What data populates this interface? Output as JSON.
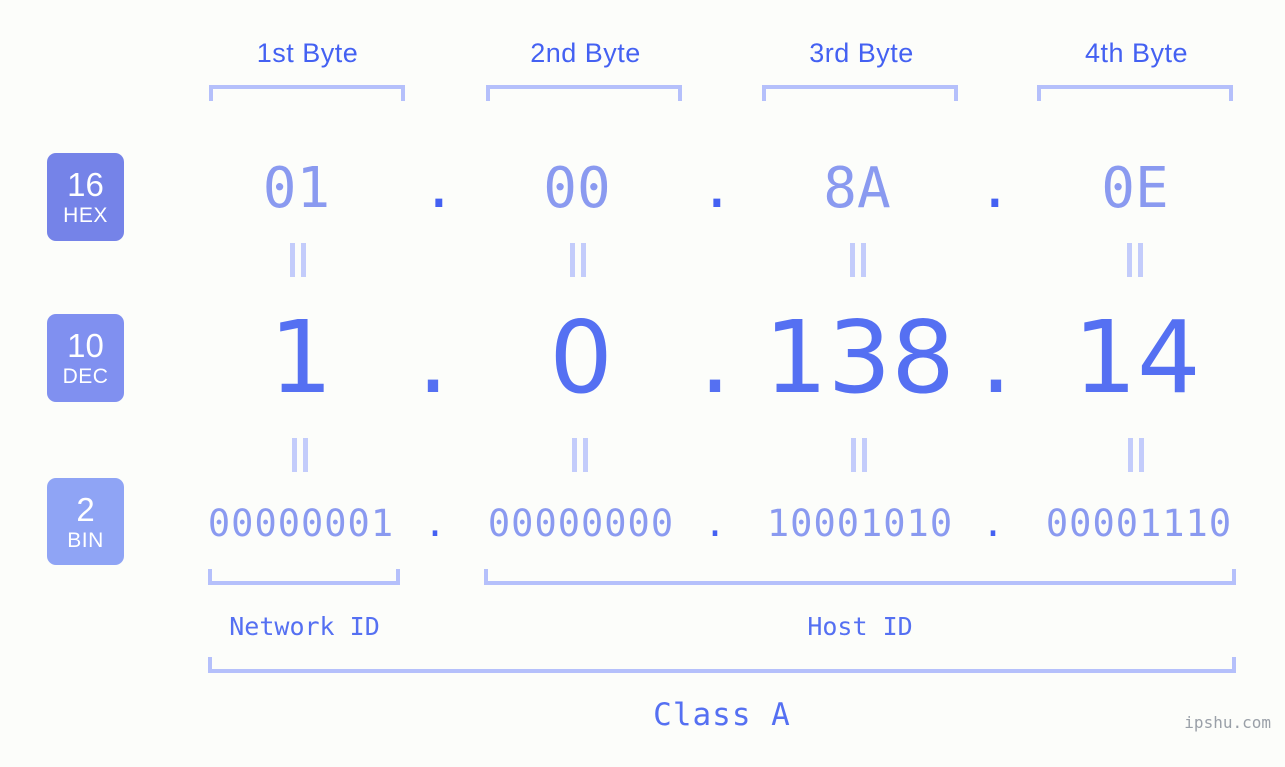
{
  "background_color": "#fcfdfa",
  "accent_color": "#4461f2",
  "bracket_color": "#b5c0fb",
  "header": {
    "byte_labels": [
      {
        "text": "1st Byte"
      },
      {
        "text": "2nd Byte"
      },
      {
        "text": "3rd Byte"
      },
      {
        "text": "4th Byte"
      }
    ]
  },
  "rows": [
    {
      "id": "hex",
      "badge_number": "16",
      "badge_name": "HEX",
      "badge_color": "#7583e8",
      "values": [
        "01",
        "00",
        "8A",
        "0E"
      ],
      "separator": "."
    },
    {
      "id": "dec",
      "badge_number": "10",
      "badge_name": "DEC",
      "badge_color": "#8090f0",
      "values": [
        "1",
        "0",
        "138",
        "14"
      ],
      "separator": "."
    },
    {
      "id": "bin",
      "badge_number": "2",
      "badge_name": "BIN",
      "badge_color": "#8fa4f5",
      "values": [
        "00000001",
        "00000000",
        "10001010",
        "00001110"
      ],
      "separator": "."
    }
  ],
  "equality_symbol": "=",
  "partition": {
    "network_id_label": "Network ID",
    "host_id_label": "Host ID"
  },
  "class_label": "Class A",
  "watermark": "ipshu.com"
}
